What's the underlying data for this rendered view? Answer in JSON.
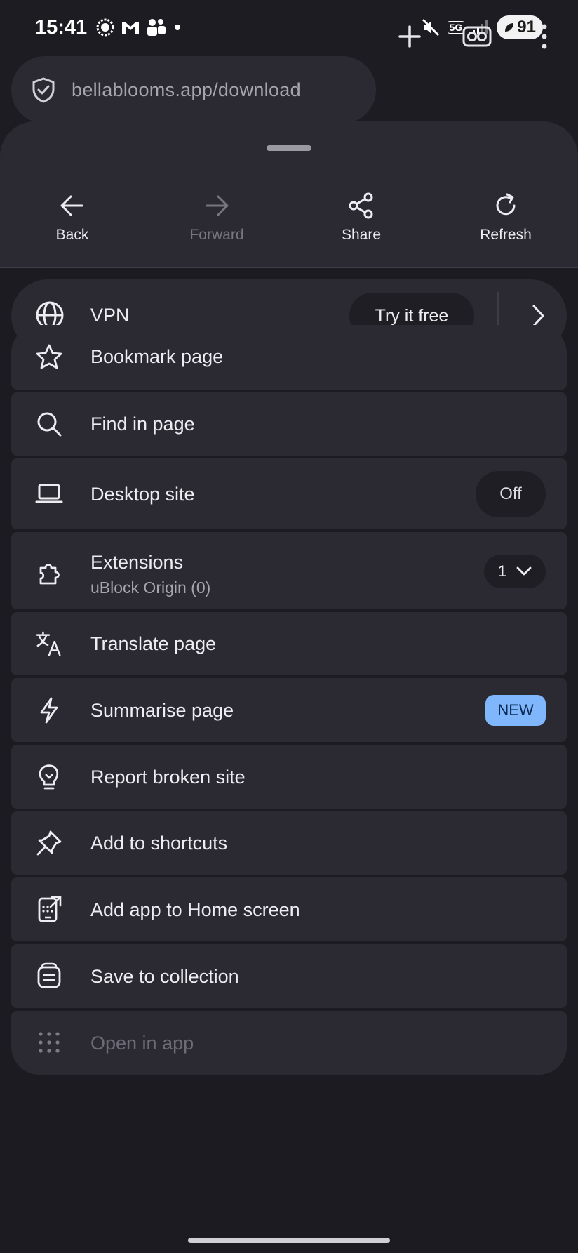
{
  "status_bar": {
    "time": "15:41",
    "network": "5G",
    "battery": "91"
  },
  "toolbar": {
    "url": "bellablooms.app/download"
  },
  "nav": {
    "back": "Back",
    "forward": "Forward",
    "share": "Share",
    "refresh": "Refresh"
  },
  "vpn": {
    "label": "VPN",
    "cta": "Try it free"
  },
  "menu": {
    "bookmark": "Bookmark page",
    "find": "Find in page",
    "desktop": "Desktop site",
    "desktop_state": "Off",
    "extensions": "Extensions",
    "extensions_sub": "uBlock Origin (0)",
    "extensions_count": "1",
    "translate": "Translate page",
    "summarise": "Summarise page",
    "summarise_badge": "NEW",
    "report": "Report broken site",
    "shortcuts": "Add to shortcuts",
    "add_app": "Add app to Home screen",
    "save_collection": "Save to collection",
    "open_in_app": "Open in app"
  },
  "colors": {
    "accent": "#80b6fb",
    "sheet": "#2b2a33",
    "background": "#1c1b22"
  },
  "icons": [
    "shield-icon",
    "plus-icon",
    "private-mask-icon",
    "more-vertical-icon",
    "arrow-left-icon",
    "arrow-right-icon",
    "share-icon",
    "refresh-icon",
    "globe-icon",
    "chevron-right-icon",
    "star-icon",
    "search-icon",
    "laptop-icon",
    "puzzle-icon",
    "translate-icon",
    "lightning-icon",
    "lightbulb-icon",
    "pin-icon",
    "add-to-home-icon",
    "collection-icon",
    "grid-icon",
    "chevron-down-icon"
  ]
}
